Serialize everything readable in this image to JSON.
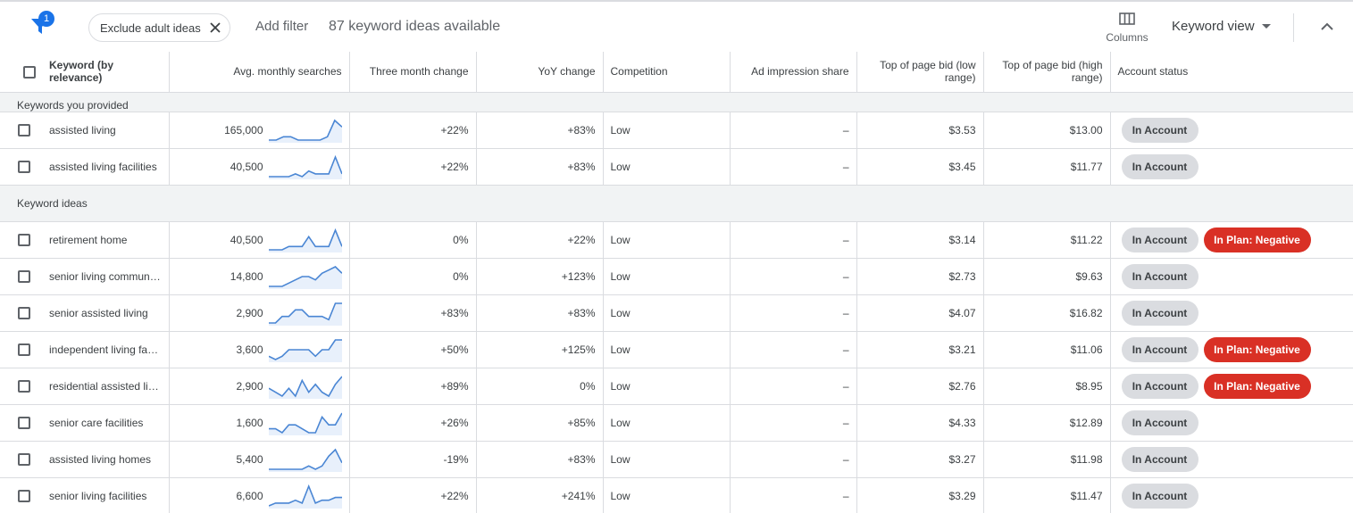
{
  "toolbar": {
    "filter_badge": "1",
    "chip_label": "Exclude adult ideas",
    "add_filter": "Add filter",
    "ideas_count": "87 keyword ideas available",
    "columns_label": "Columns",
    "keyword_view": "Keyword view"
  },
  "columns": {
    "keyword": "Keyword (by relevance)",
    "avg_searches": "Avg. monthly searches",
    "three_month": "Three month change",
    "yoy": "YoY change",
    "competition": "Competition",
    "ad_impression": "Ad impression share",
    "bid_low": "Top of page bid (low range)",
    "bid_high": "Top of page bid (high range)",
    "account_status": "Account status"
  },
  "groups": {
    "provided": "Keywords you provided",
    "ideas": "Keyword ideas"
  },
  "colors": {
    "spark_line": "#4a86d4",
    "spark_fill": "#e8f0fb",
    "negative_pill": "#d93025",
    "account_pill": "#dadce0"
  },
  "rows": [
    {
      "keyword": "assisted living",
      "avg": "165,000",
      "three_month": "+22%",
      "yoy": "+83%",
      "competition": "Low",
      "ais": "–",
      "low": "$3.53",
      "high": "$13.00",
      "status": [
        "In Account"
      ],
      "trend": [
        2,
        2,
        3,
        3,
        2,
        2,
        2,
        2,
        3,
        8,
        6
      ]
    },
    {
      "keyword": "assisted living facilities",
      "avg": "40,500",
      "three_month": "+22%",
      "yoy": "+83%",
      "competition": "Low",
      "ais": "–",
      "low": "$3.45",
      "high": "$11.77",
      "status": [
        "In Account"
      ],
      "trend": [
        2,
        2,
        2,
        2,
        3,
        2,
        4,
        3,
        3,
        3,
        9,
        3
      ]
    },
    {
      "keyword": "retirement home",
      "avg": "40,500",
      "three_month": "0%",
      "yoy": "+22%",
      "competition": "Low",
      "ais": "–",
      "low": "$3.14",
      "high": "$11.22",
      "status": [
        "In Account",
        "In Plan: Negative"
      ],
      "trend": [
        2,
        2,
        2,
        3,
        3,
        3,
        6,
        3,
        3,
        3,
        8,
        3
      ]
    },
    {
      "keyword": "senior living communities",
      "avg": "14,800",
      "three_month": "0%",
      "yoy": "+123%",
      "competition": "Low",
      "ais": "–",
      "low": "$2.73",
      "high": "$9.63",
      "status": [
        "In Account"
      ],
      "trend": [
        2,
        2,
        2,
        3,
        4,
        5,
        5,
        4,
        6,
        7,
        8,
        6
      ]
    },
    {
      "keyword": "senior assisted living",
      "avg": "2,900",
      "three_month": "+83%",
      "yoy": "+83%",
      "competition": "Low",
      "ais": "–",
      "low": "$4.07",
      "high": "$16.82",
      "status": [
        "In Account"
      ],
      "trend": [
        2,
        2,
        4,
        4,
        6,
        6,
        4,
        4,
        4,
        3,
        8,
        8
      ]
    },
    {
      "keyword": "independent living facilities",
      "avg": "3,600",
      "three_month": "+50%",
      "yoy": "+125%",
      "competition": "Low",
      "ais": "–",
      "low": "$3.21",
      "high": "$11.06",
      "status": [
        "In Account",
        "In Plan: Negative"
      ],
      "trend": [
        3,
        2,
        3,
        5,
        5,
        5,
        5,
        3,
        5,
        5,
        8,
        8
      ]
    },
    {
      "keyword": "residential assisted living",
      "avg": "2,900",
      "three_month": "+89%",
      "yoy": "0%",
      "competition": "Low",
      "ais": "–",
      "low": "$2.76",
      "high": "$8.95",
      "status": [
        "In Account",
        "In Plan: Negative"
      ],
      "trend": [
        4,
        3,
        2,
        4,
        2,
        6,
        3,
        5,
        3,
        2,
        5,
        7
      ]
    },
    {
      "keyword": "senior care facilities",
      "avg": "1,600",
      "three_month": "+26%",
      "yoy": "+85%",
      "competition": "Low",
      "ais": "–",
      "low": "$4.33",
      "high": "$12.89",
      "status": [
        "In Account"
      ],
      "trend": [
        3,
        3,
        2,
        4,
        4,
        3,
        2,
        2,
        6,
        4,
        4,
        7
      ]
    },
    {
      "keyword": "assisted living homes",
      "avg": "5,400",
      "three_month": "-19%",
      "yoy": "+83%",
      "competition": "Low",
      "ais": "–",
      "low": "$3.27",
      "high": "$11.98",
      "status": [
        "In Account"
      ],
      "trend": [
        2,
        2,
        2,
        2,
        2,
        2,
        3,
        2,
        3,
        6,
        8,
        4
      ]
    },
    {
      "keyword": "senior living facilities",
      "avg": "6,600",
      "three_month": "+22%",
      "yoy": "+241%",
      "competition": "Low",
      "ais": "–",
      "low": "$3.29",
      "high": "$11.47",
      "status": [
        "In Account"
      ],
      "trend": [
        2,
        3,
        3,
        3,
        4,
        3,
        9,
        3,
        4,
        4,
        5,
        5
      ]
    }
  ]
}
